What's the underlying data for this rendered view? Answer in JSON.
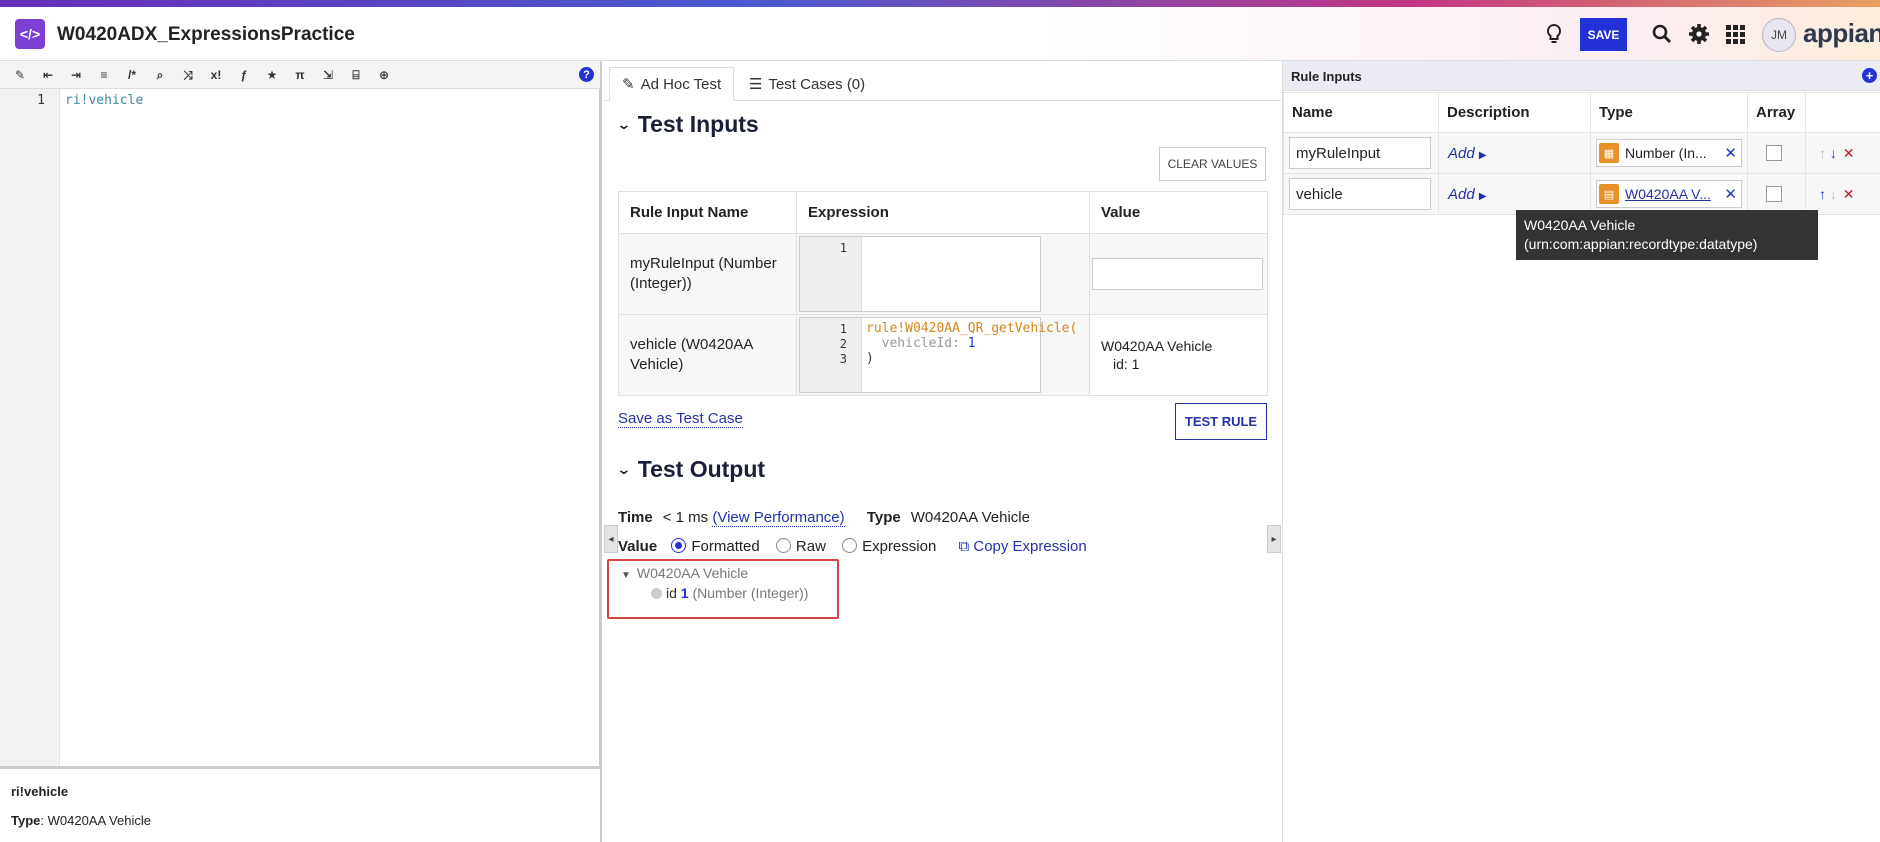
{
  "app": {
    "title": "W0420ADX_ExpressionsPractice",
    "save_label": "SAVE",
    "avatar_initials": "JM",
    "brand": "appian"
  },
  "editor": {
    "line_number": "1",
    "code": "ri!vehicle",
    "info_name": "ri!vehicle",
    "info_type_label": "Type",
    "info_type_value": ": W0420AA Vehicle"
  },
  "tabs": [
    {
      "label": "Ad Hoc Test"
    },
    {
      "label": "Test Cases (0)"
    }
  ],
  "test_inputs": {
    "title": "Test Inputs",
    "clear_label": "CLEAR VALUES",
    "headers": [
      "Rule Input Name",
      "Expression",
      "Value"
    ],
    "rows": [
      {
        "name": "myRuleInput (Number (Integer))",
        "lines": [
          "1"
        ],
        "value": ""
      },
      {
        "name": "vehicle (W0420AA Vehicle)",
        "lines": [
          "1",
          "2",
          "3"
        ],
        "code_l1": "rule!W0420AA_QR_getVehicle(",
        "code_l2_key": "  vehicleId: ",
        "code_l2_val": "1",
        "code_l3": ")",
        "value_l1": "W0420AA Vehicle",
        "value_l2": "id: 1"
      }
    ],
    "save_test_case": "Save as Test Case",
    "test_rule": "TEST RULE"
  },
  "test_output": {
    "title": "Test Output",
    "time_label": "Time",
    "time_value": "< 1 ms",
    "view_perf": "(View Performance)",
    "type_label": "Type",
    "type_value": "W0420AA Vehicle",
    "value_label": "Value",
    "options": [
      "Formatted",
      "Raw",
      "Expression"
    ],
    "selected": "Formatted",
    "copy_label": "Copy Expression",
    "tree_root": "W0420AA Vehicle",
    "tree_key": "id",
    "tree_val": "1",
    "tree_type": "(Number (Integer))"
  },
  "rule_inputs": {
    "title": "Rule Inputs",
    "headers": [
      "Name",
      "Description",
      "Type",
      "Array"
    ],
    "rows": [
      {
        "name": "myRuleInput",
        "desc": "Add",
        "type": "Number (In..."
      },
      {
        "name": "vehicle",
        "desc": "Add",
        "type": "W0420AA V..."
      }
    ],
    "tooltip_l1": "W0420AA Vehicle",
    "tooltip_l2": "(urn:com:appian:recordtype:datatype)"
  },
  "colors": {
    "accent": "#2332d6",
    "app_icon": "#7c3fd4",
    "type_icon": "#e8912a",
    "highlight": "#d64545"
  }
}
